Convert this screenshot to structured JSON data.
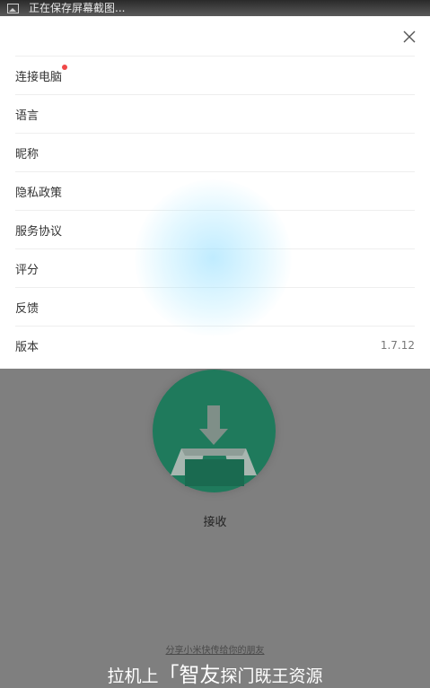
{
  "status_bar": {
    "notification_text": "正在保存屏幕截图..."
  },
  "sheet": {
    "items": [
      {
        "label": "连接电脑",
        "has_badge": true
      },
      {
        "label": "语言"
      },
      {
        "label": "昵称"
      },
      {
        "label": "隐私政策"
      },
      {
        "label": "服务协议"
      },
      {
        "label": "评分"
      },
      {
        "label": "反馈"
      },
      {
        "label": "版本",
        "value": "1.7.12"
      }
    ]
  },
  "main": {
    "receive_label": "接收",
    "share_link": "分享小米快传给你的朋友",
    "slogan_prefix": "拉机上",
    "slogan_brand": "「智友",
    "slogan_suffix": "探门既王资源"
  },
  "colors": {
    "badge": "#f04848",
    "receive_button": "#1f7a5c",
    "sheet_bg": "#ffffff",
    "overlay": "#7f7f7f"
  }
}
